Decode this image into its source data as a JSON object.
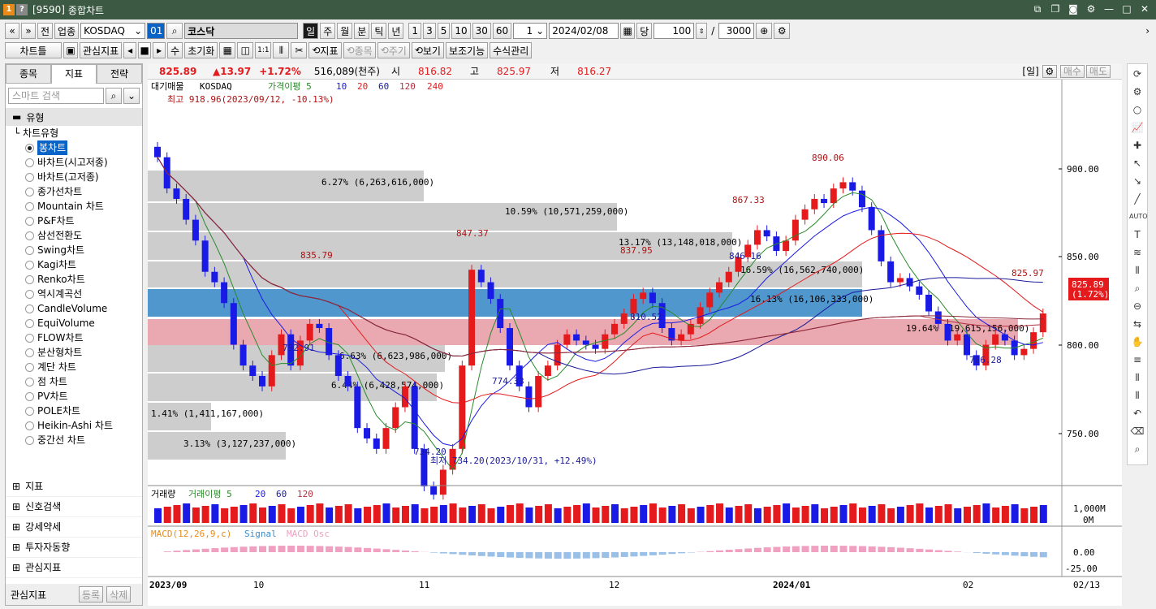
{
  "window": {
    "code": "[9590]",
    "title": "종합차트"
  },
  "toolbar1": {
    "nav_first": "«",
    "nav_prev": "»",
    "jeon": "전",
    "upjong": "업종",
    "market": "KOSDAQ",
    "code": "01",
    "search_icon": "search-icon",
    "name": "코스닥",
    "periods": [
      "일",
      "주",
      "월",
      "분",
      "틱",
      "년"
    ],
    "active_period": "일",
    "nums": [
      "1",
      "3",
      "5",
      "10",
      "30",
      "60"
    ],
    "unit": "1",
    "date": "2024/02/08",
    "dang": "당",
    "count": "100",
    "slash": "/",
    "total": "3000"
  },
  "toolbar2": {
    "chart_type": "차트틀",
    "fav": "관심지표",
    "su": "수",
    "reset": "초기화",
    "indicator": "지표",
    "jongmok": "종목",
    "jugi": "주기",
    "view": "보기",
    "aux": "보조기능",
    "formula": "수식관리"
  },
  "infobar": {
    "price": "825.89",
    "change": "▲13.97",
    "pct": "+1.72%",
    "volume": "516,089(천주)",
    "open_label": "시",
    "open": "816.82",
    "high_label": "고",
    "high": "825.97",
    "low_label": "저",
    "low": "816.27",
    "period": "[일]",
    "buy": "매수",
    "sell": "매도"
  },
  "left": {
    "tabs": [
      "종목",
      "지표",
      "전략"
    ],
    "active_tab": "지표",
    "search_placeholder": "스마트 검색",
    "group": "유형",
    "subgroup": "차트유형",
    "items": [
      "봉차트",
      "바차트(시고저종)",
      "바차트(고저종)",
      "종가선차트",
      "Mountain 차트",
      "P&F차트",
      "삼선전환도",
      "Swing차트",
      "Kagi차트",
      "Renko차트",
      "역시계곡선",
      "CandleVolume",
      "EquiVolume",
      "FLOW차트",
      "분산형차트",
      "계단 차트",
      "점 차트",
      "PV차트",
      "POLE차트",
      "Heikin-Ashi 차트",
      "중간선 차트"
    ],
    "selected": "봉차트",
    "bottom": [
      "지표",
      "신호검색",
      "강세약세",
      "투자자동향",
      "관심지표"
    ],
    "fav_label": "관심지표",
    "register": "등록",
    "delete": "삭제"
  },
  "chart": {
    "legend": [
      "대기매물",
      "KOSDAQ",
      "가격이평 5",
      "10",
      "20",
      "60",
      "120",
      "240"
    ],
    "high_note": "최고 918.96(2023/09/12, -10.13%)",
    "low_note": "최저 734.20(2023/10/31, +12.49%)",
    "y_ticks": [
      "900.00",
      "850.00",
      "800.00",
      "750.00"
    ],
    "current_price": "825.89",
    "current_pct": "(1.72%)",
    "x_labels": [
      "2023/09",
      "10",
      "11",
      "12",
      "2024/01",
      "02",
      "02/13"
    ],
    "peaks": [
      "890.06",
      "867.33",
      "847.37",
      "837.95",
      "835.79",
      "825.97"
    ],
    "troughs": [
      "792.91",
      "774.33",
      "810.52",
      "846.16",
      "786.28",
      "734.20"
    ],
    "volume_profile": [
      {
        "label": "6.27% (6,263,616,000)",
        "pct": 6.27
      },
      {
        "label": "10.59% (10,571,259,000)",
        "pct": 10.59
      },
      {
        "label": "13.17% (13,148,018,000)",
        "pct": 13.17
      },
      {
        "label": "16.59% (16,562,740,000)",
        "pct": 16.59
      },
      {
        "label": "16.13% (16,106,333,000)",
        "pct": 16.13
      },
      {
        "label": "19.64% (19,615,156,000)",
        "pct": 19.64
      },
      {
        "label": "6.63% (6,623,986,000)",
        "pct": 6.63
      },
      {
        "label": "6.44% (6,428,574,000)",
        "pct": 6.44
      },
      {
        "label": "1.41% (1,411,167,000)",
        "pct": 1.41
      },
      {
        "label": "3.13% (3,127,237,000)",
        "pct": 3.13
      }
    ],
    "vol_legend": [
      "거래량",
      "거래이평 5",
      "20",
      "60",
      "120"
    ],
    "vol_ticks": [
      "1,000M",
      "0M"
    ],
    "macd_legend": [
      "MACD(12,26,9,c)",
      "Signal",
      "MACD Osc"
    ],
    "macd_ticks": [
      "0.00",
      "-25.00"
    ]
  },
  "colors": {
    "up": "#e41a1c",
    "down": "#1a1ae6",
    "profile": "#c8c8c8",
    "profile_blue": "#3c8cc8",
    "profile_red": "#e8a0a8"
  }
}
